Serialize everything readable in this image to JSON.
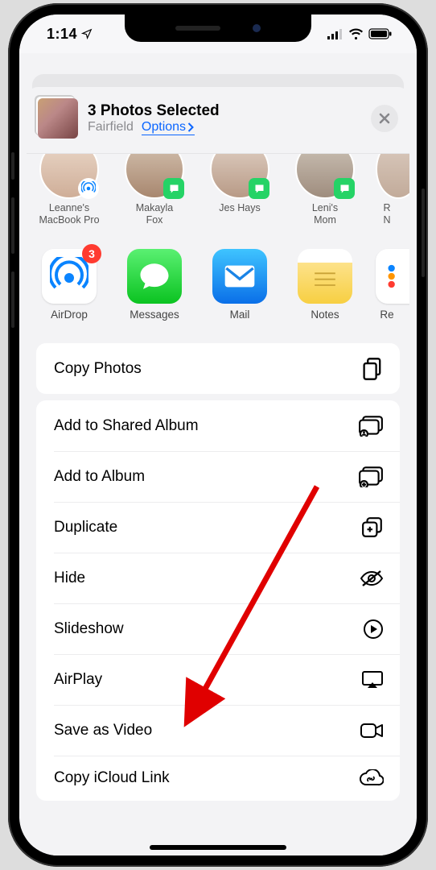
{
  "status_bar": {
    "time": "1:14"
  },
  "header": {
    "title": "3 Photos Selected",
    "location": "Fairfield",
    "options_label": "Options"
  },
  "contacts": [
    {
      "name_line1": "Leanne's",
      "name_line2": "MacBook Pro",
      "badge": "airdrop"
    },
    {
      "name_line1": "Makayla",
      "name_line2": "Fox",
      "badge": "messages"
    },
    {
      "name_line1": "Jes Hays",
      "name_line2": "",
      "badge": "messages"
    },
    {
      "name_line1": "Leni's",
      "name_line2": "Mom",
      "badge": "messages"
    },
    {
      "name_line1": "R",
      "name_line2": "N",
      "badge": ""
    }
  ],
  "apps": [
    {
      "label": "AirDrop",
      "icon": "airdrop",
      "badge": "3"
    },
    {
      "label": "Messages",
      "icon": "messages",
      "badge": ""
    },
    {
      "label": "Mail",
      "icon": "mail",
      "badge": ""
    },
    {
      "label": "Notes",
      "icon": "notes",
      "badge": ""
    },
    {
      "label": "Re",
      "icon": "reminders",
      "badge": ""
    }
  ],
  "actions_group1": [
    {
      "label": "Copy Photos",
      "icon": "copy"
    }
  ],
  "actions_group2": [
    {
      "label": "Add to Shared Album",
      "icon": "shared-album"
    },
    {
      "label": "Add to Album",
      "icon": "add-album"
    },
    {
      "label": "Duplicate",
      "icon": "duplicate"
    },
    {
      "label": "Hide",
      "icon": "hide"
    },
    {
      "label": "Slideshow",
      "icon": "play-circle"
    },
    {
      "label": "AirPlay",
      "icon": "airplay"
    },
    {
      "label": "Save as Video",
      "icon": "video"
    },
    {
      "label": "Copy iCloud Link",
      "icon": "cloud-link"
    }
  ]
}
